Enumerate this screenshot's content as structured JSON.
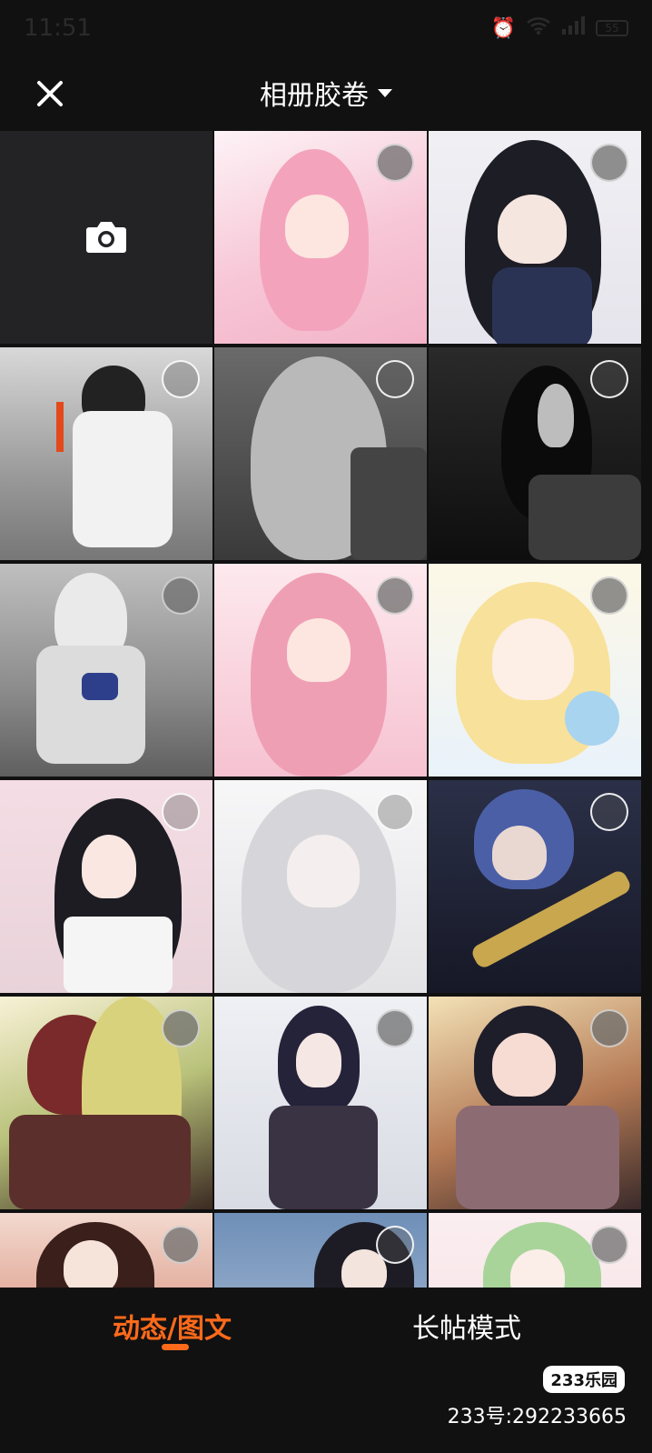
{
  "status_bar": {
    "time": "11:51",
    "battery": "55"
  },
  "header": {
    "title": "相册胶卷"
  },
  "tabs": [
    {
      "label": "动态/图文"
    },
    {
      "label": "长帖模式"
    }
  ],
  "watermark": {
    "logo": "233乐园",
    "id": "233号:292233665"
  },
  "colors": {
    "accent": "#ff6a1a",
    "background": "#111112"
  },
  "icons": {
    "close": "close-icon",
    "camera": "camera-icon",
    "dropdown": "caret-down-icon"
  }
}
